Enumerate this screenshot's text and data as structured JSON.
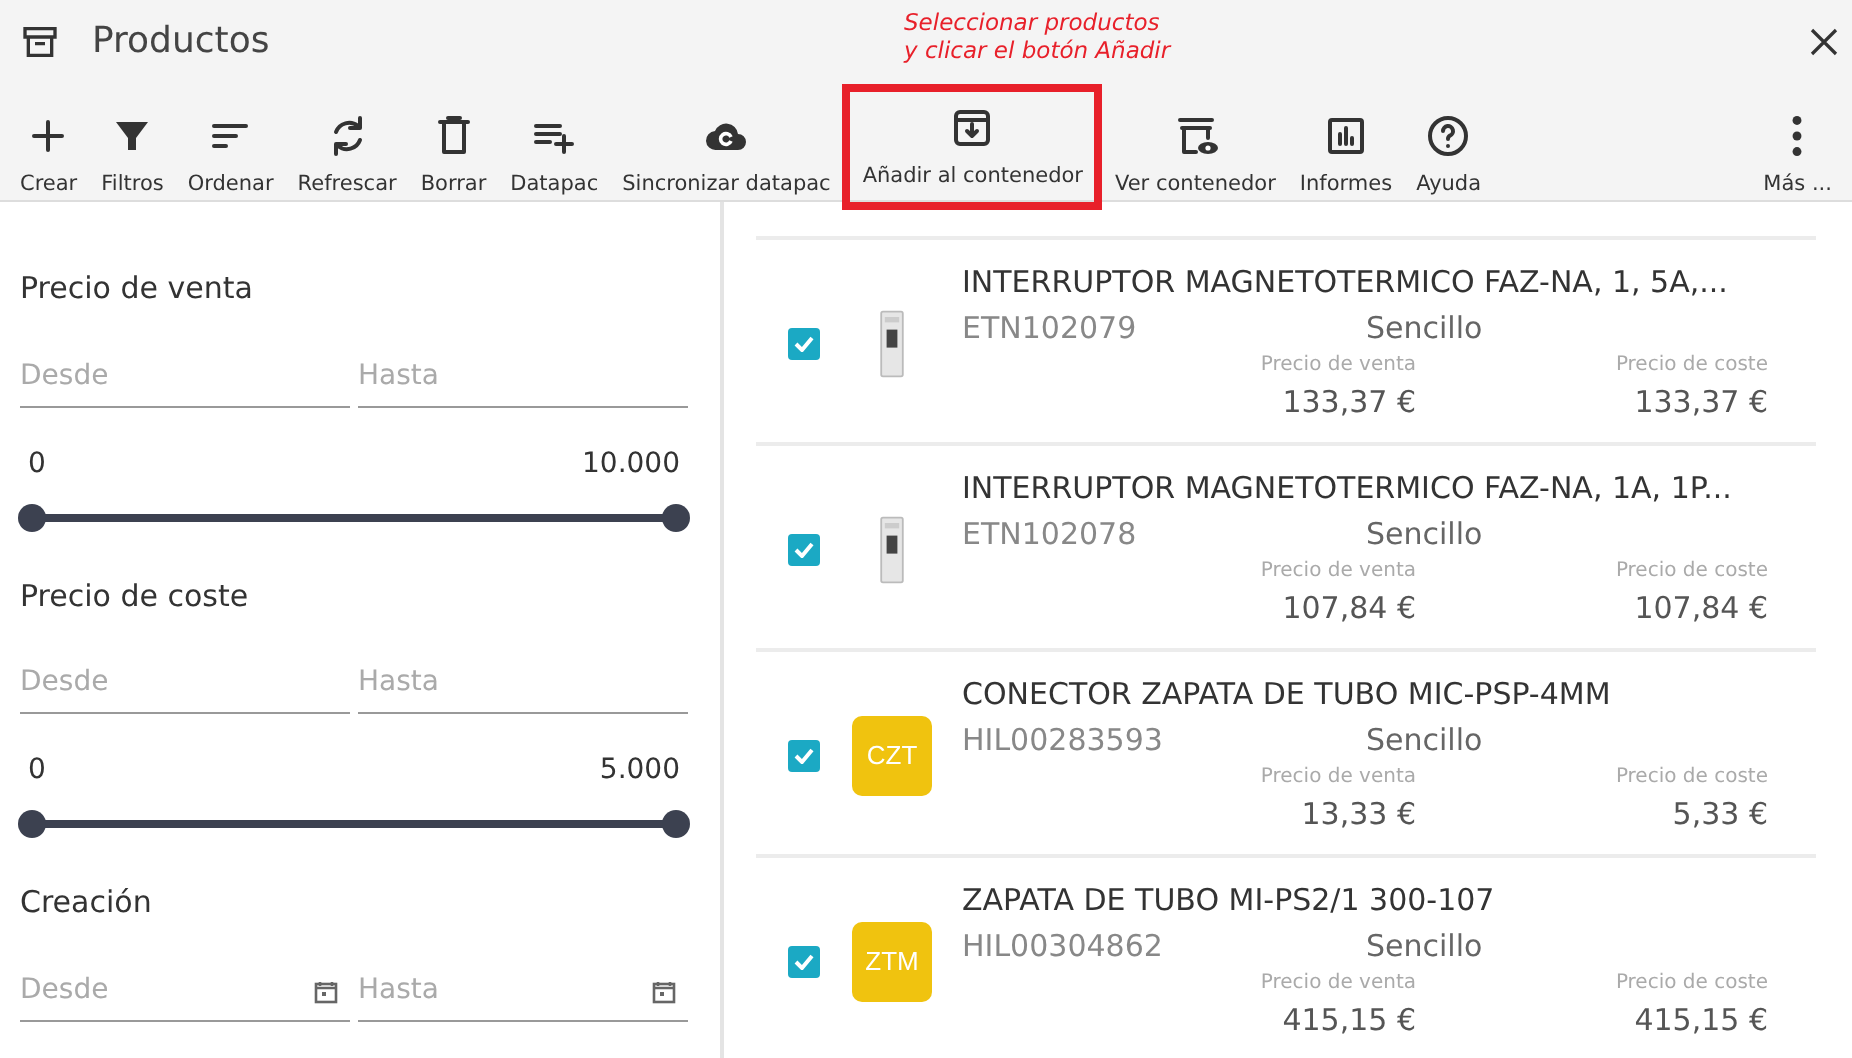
{
  "window": {
    "title": "Productos"
  },
  "annotation": {
    "lines": [
      "Seleccionar productos",
      "y clicar el botón Añadir"
    ]
  },
  "toolbar": [
    {
      "label": "Crear",
      "highlighted": false
    },
    {
      "label": "Filtros",
      "highlighted": false
    },
    {
      "label": "Ordenar",
      "highlighted": false
    },
    {
      "label": "Refrescar",
      "highlighted": false
    },
    {
      "label": "Borrar",
      "highlighted": false
    },
    {
      "label": "Datapac",
      "highlighted": false
    },
    {
      "label": "Sincronizar datapac",
      "highlighted": false
    },
    {
      "label": "Añadir al contenedor",
      "highlighted": true
    },
    {
      "label": "Ver contenedor",
      "highlighted": false
    },
    {
      "label": "Informes",
      "highlighted": false
    },
    {
      "label": "Ayuda",
      "highlighted": false
    },
    {
      "label": "Más ...",
      "highlighted": false
    }
  ],
  "filters": [
    {
      "kind": "range",
      "title": "Precio de venta",
      "from": {
        "placeholder": "Desde"
      },
      "to": {
        "placeholder": "Hasta"
      },
      "min_label": "0",
      "max_label": "10.000",
      "thumbs": [
        {
          "level": 0
        },
        {
          "level": 1
        }
      ]
    },
    {
      "kind": "range",
      "title": "Precio de coste",
      "from": {
        "placeholder": "Desde"
      },
      "to": {
        "placeholder": "Hasta"
      },
      "min_label": "0",
      "max_label": "5.000",
      "thumbs": [
        {
          "level": 0
        },
        {
          "level": 1
        }
      ]
    },
    {
      "kind": "date",
      "title": "Creación",
      "from": {
        "placeholder": "Desde"
      },
      "to": {
        "placeholder": "Hasta"
      }
    }
  ],
  "products": [
    {
      "selected": true,
      "thumb": {
        "kind": "photo"
      },
      "name": "INTERRUPTOR MAGNETOTERMICO FAZ-NA, 1, 5A,...",
      "code": "ETN102079",
      "type": "Sencillo",
      "sale_label": "Precio de venta",
      "sale": "133,37 €",
      "cost_label": "Precio de coste",
      "cost": "133,37 €"
    },
    {
      "selected": true,
      "thumb": {
        "kind": "photo"
      },
      "name": "INTERRUPTOR MAGNETOTERMICO FAZ-NA, 1A, 1P...",
      "code": "ETN102078",
      "type": "Sencillo",
      "sale_label": "Precio de venta",
      "sale": "107,84 €",
      "cost_label": "Precio de coste",
      "cost": "107,84 €"
    },
    {
      "selected": true,
      "thumb": {
        "kind": "initials",
        "text": "CZT",
        "color": "#f0c30f"
      },
      "name": "CONECTOR ZAPATA DE TUBO MIC-PSP-4MM",
      "code": "HIL00283593",
      "type": "Sencillo",
      "sale_label": "Precio de venta",
      "sale": "13,33 €",
      "cost_label": "Precio de coste",
      "cost": "5,33 €"
    },
    {
      "selected": true,
      "thumb": {
        "kind": "initials",
        "text": "ZTM",
        "color": "#f0c30f"
      },
      "name": "ZAPATA DE TUBO MI-PS2/1 300-107",
      "code": "HIL00304862",
      "type": "Sencillo",
      "sale_label": "Precio de venta",
      "sale": "415,15 €",
      "cost_label": "Precio de coste",
      "cost": "415,15 €"
    }
  ]
}
